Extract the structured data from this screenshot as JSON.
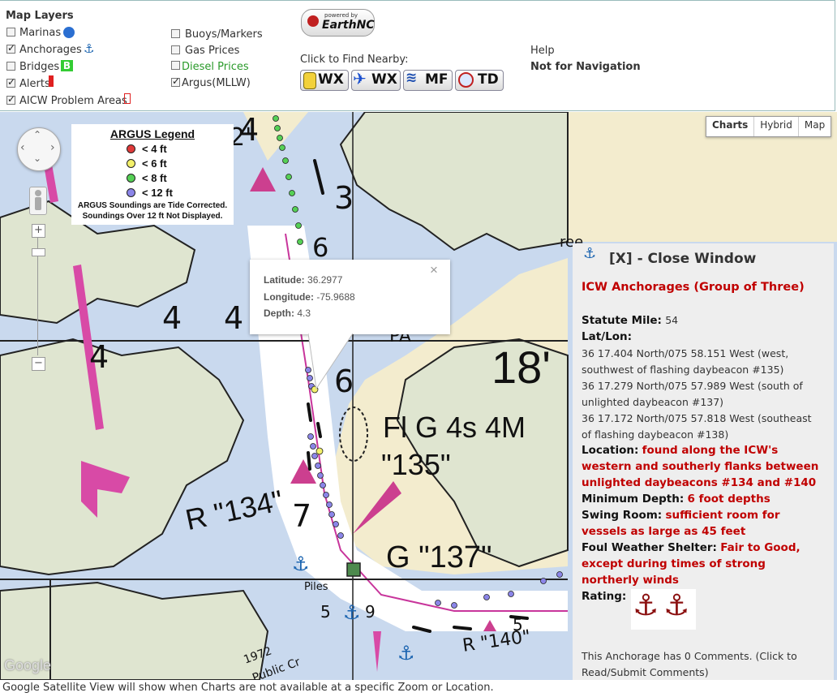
{
  "layers": {
    "title": "Map Layers",
    "items": [
      {
        "label": "Marinas",
        "checked": false
      },
      {
        "label": "Anchorages",
        "checked": true
      },
      {
        "label": "Bridges",
        "checked": false
      },
      {
        "label": "Alerts",
        "checked": true
      },
      {
        "label": "AICW Problem Areas",
        "checked": true
      },
      {
        "label": "Buoys/Markers",
        "checked": false
      },
      {
        "label": "Gas Prices",
        "checked": false
      },
      {
        "label": "Diesel Prices",
        "checked": false
      },
      {
        "label": "Argus(MLLW)",
        "checked": true
      }
    ]
  },
  "powered": {
    "top": "powered by",
    "brand": "EarthNC"
  },
  "nearby": {
    "label": "Click to Find Nearby:",
    "buttons": [
      "WX",
      "WX",
      "MF",
      "TD"
    ]
  },
  "help": {
    "label": "Help",
    "note": "Not for Navigation"
  },
  "maptype": {
    "options": [
      "Charts",
      "Hybrid",
      "Map"
    ],
    "selected": "Charts"
  },
  "legend": {
    "title": "ARGUS Legend",
    "items": [
      {
        "label": "< 4 ft",
        "color": "#e03a3a"
      },
      {
        "label": "< 6 ft",
        "color": "#f3f06a"
      },
      {
        "label": "< 8 ft",
        "color": "#55d055"
      },
      {
        "label": "< 12 ft",
        "color": "#8b85e8"
      }
    ],
    "note1": "ARGUS Soundings are Tide Corrected.",
    "note2": "Soundings Over 12 ft Not Displayed."
  },
  "popup": {
    "lat_label": "Latitude:",
    "lat": "36.2977",
    "lon_label": "Longitude:",
    "lon": "-75.9688",
    "depth_label": "Depth:",
    "depth": "4.3",
    "close": "×"
  },
  "chart_labels": {
    "n4a": "4",
    "n3": "3",
    "n4b": "4",
    "n4c": "4",
    "n4d": "4",
    "n6": "6",
    "n6b": "6",
    "n7": "7",
    "n18": "18'",
    "light": "Fl G 4s 4M",
    "q135": "\"135\"",
    "r134": "R \"134\"",
    "g137": "G \"137\"",
    "pa": "PA",
    "piles": "Piles",
    "r140": "R \"140\"",
    "n5a": "5",
    "n5b": "5",
    "n9": "9",
    "n1972": "1972",
    "public": "Public Cr",
    "ree": "ree",
    "n2": "2\"",
    "google": "Google"
  },
  "info": {
    "close": "[X] - Close Window",
    "title": "ICW Anchorages (Group of Three)",
    "statute_label": "Statute Mile:",
    "statute": "54",
    "latlon_label": "Lat/Lon:",
    "latlon": [
      "36 17.404 North/075 58.151 West (west,",
      "southwest of flashing daybeacon #135)",
      "36 17.279 North/075 57.989 West (south of",
      "unlighted daybeacon #137)",
      "36 17.172 North/075 57.818 West (southeast",
      "of flashing daybeacon #138)"
    ],
    "location_label": "Location:",
    "location": [
      "found along the ICW's",
      "western and southerly flanks between",
      "unlighted daybeacons #134 and #140"
    ],
    "min_depth_label": "Minimum Depth:",
    "min_depth": "6 foot depths",
    "swing_label": "Swing Room:",
    "swing": [
      "sufficient room for",
      "vessels as large as 45 feet"
    ],
    "shelter_label": "Foul Weather Shelter:",
    "shelter": [
      "Fair to Good,",
      "except during times of strong",
      "northerly winds"
    ],
    "rating_label": "Rating:",
    "comments": [
      "This Anchorage has 0 Comments. (Click to",
      "Read/Submit Comments)"
    ]
  },
  "footer": "Google Satellite View will show when Charts are not available at a specific Zoom or Location."
}
